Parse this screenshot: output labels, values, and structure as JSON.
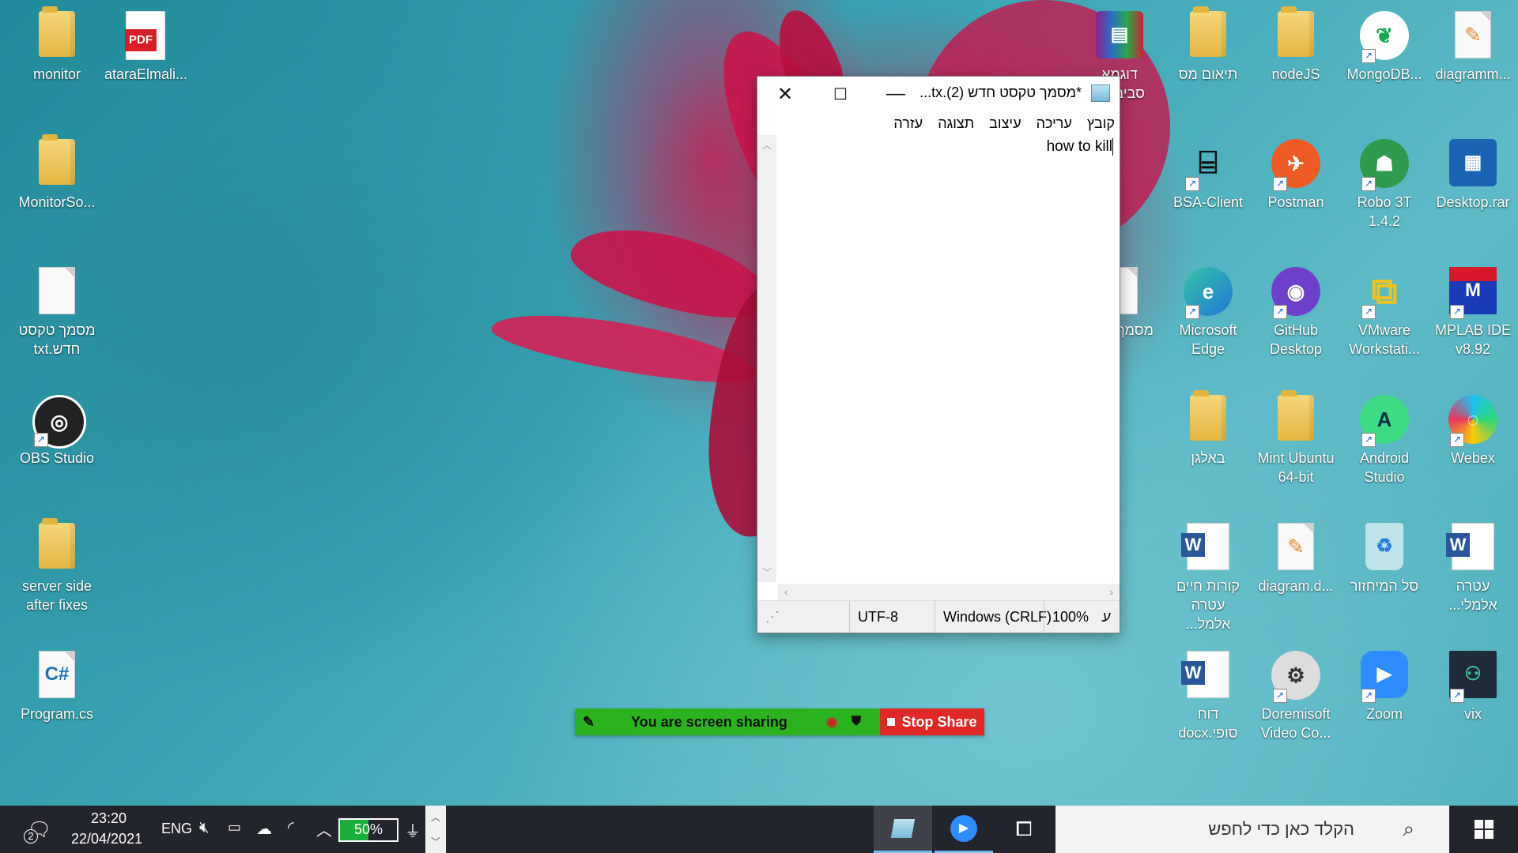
{
  "desktop": {
    "left_icons": [
      {
        "label": "monitor",
        "type": "folder"
      },
      {
        "label": "ataraElmali...",
        "type": "pdf"
      },
      {
        "label": "MonitorSo...",
        "type": "folder"
      },
      {
        "label": "מסמך טקסט חדש.txt",
        "type": "doc"
      },
      {
        "label": "OBS Studio",
        "type": "obs"
      },
      {
        "label": "server side after fixes",
        "type": "folder"
      },
      {
        "label": "Program.cs",
        "type": "cs"
      }
    ],
    "right_icons": [
      {
        "label": "דוגמא סביבה...",
        "type": "rar"
      },
      {
        "label": "תיאום מס",
        "type": "folder"
      },
      {
        "label": "nodeJS",
        "type": "folder"
      },
      {
        "label": "MongoDB...",
        "type": "mongo"
      },
      {
        "label": "diagramm...",
        "type": "diagram"
      },
      {
        "label": "BSA-Client",
        "type": "bsa"
      },
      {
        "label": "Postman",
        "type": "postman"
      },
      {
        "label": "Robo 3T 1.4.2",
        "type": "robo"
      },
      {
        "label": "Desktop.rar",
        "type": "rar2"
      },
      {
        "label": "מסמך חדש",
        "type": "doc"
      },
      {
        "label": "Microsoft Edge",
        "type": "edge"
      },
      {
        "label": "GitHub Desktop",
        "type": "github"
      },
      {
        "label": "VMware Workstati...",
        "type": "vmware"
      },
      {
        "label": "MPLAB IDE v8.92",
        "type": "mplab"
      },
      {
        "label": "באלגן",
        "type": "folder"
      },
      {
        "label": "Mint Ubuntu 64-bit",
        "type": "folder"
      },
      {
        "label": "Android Studio",
        "type": "android"
      },
      {
        "label": "Webex",
        "type": "webex"
      },
      {
        "label": "קורות חיים עטרה אלמל...",
        "type": "word"
      },
      {
        "label": "diagram.d...",
        "type": "diagram"
      },
      {
        "label": "סל המיחזור",
        "type": "recycle"
      },
      {
        "label": "עטרה אלמלי...",
        "type": "word"
      },
      {
        "label": "דוח סופי.docx",
        "type": "word"
      },
      {
        "label": "Doremisoft Video Co...",
        "type": "doremi"
      },
      {
        "label": "Zoom",
        "type": "zoom"
      },
      {
        "label": "vix",
        "type": "vix"
      }
    ]
  },
  "notepad": {
    "title": "*מסמך טקסט חדש (2).tx...",
    "menu": [
      "קובץ",
      "עריכה",
      "עיצוב",
      "תצוגה",
      "עזרה"
    ],
    "content": "how to kill",
    "status": {
      "zoom": "100%",
      "line_ending": "Windows (CRLF)",
      "encoding": "UTF-8",
      "dir_indicator": "ע"
    }
  },
  "zoom_share": {
    "message": "You are screen sharing",
    "stop_label": "Stop Share"
  },
  "taskbar": {
    "search_placeholder": "הקלד כאן כדי לחפש",
    "battery": "50%",
    "language": "ENG",
    "time": "23:20",
    "date": "22/04/2021",
    "notification_count": "2"
  }
}
